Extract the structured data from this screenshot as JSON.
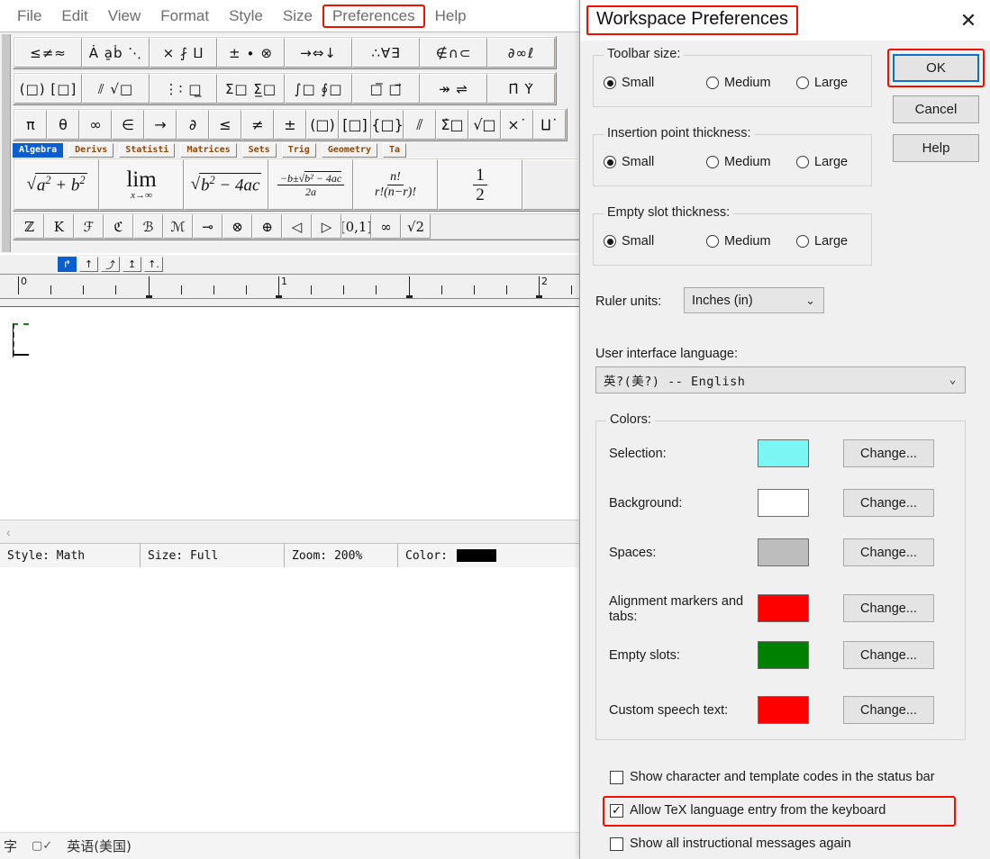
{
  "app": {
    "menu": [
      {
        "label": "File",
        "highlighted": false
      },
      {
        "label": "Edit",
        "highlighted": false
      },
      {
        "label": "View",
        "highlighted": false
      },
      {
        "label": "Format",
        "highlighted": false
      },
      {
        "label": "Style",
        "highlighted": false
      },
      {
        "label": "Size",
        "highlighted": false
      },
      {
        "label": "Preferences",
        "highlighted": true
      },
      {
        "label": "Help",
        "highlighted": false
      }
    ],
    "toolbar": {
      "row1": [
        "≤≠≈",
        "Ȧ a̱ḃ ⋱",
        "⨯ ⨏ ⨿",
        "± ∙ ⊗",
        "→⇔↓",
        "∴∀∃",
        "∉∩⊂",
        "∂∞ℓ"
      ],
      "row2": [
        "(□) [□]",
        "⫽ √□",
        "⋮∶ □̲",
        "Σ□ Σ̲□",
        "∫□ ∮□",
        "□̅ □⃗",
        "↠ ⇌",
        "Π̇ Υ̇"
      ],
      "row3": [
        "π",
        "θ",
        "∞",
        "∈",
        "→",
        "∂",
        "≤",
        "≠",
        "±",
        "(□)",
        "[□]",
        "{□}",
        "⫽",
        "Σ̇□",
        "√□",
        "⨯˙",
        "⨿˙"
      ],
      "tabs": [
        {
          "label": "Algebra",
          "active": true
        },
        {
          "label": "Derivs",
          "active": false
        },
        {
          "label": "Statisti",
          "active": false
        },
        {
          "label": "Matrices",
          "active": false
        },
        {
          "label": "Sets",
          "active": false
        },
        {
          "label": "Trig",
          "active": false
        },
        {
          "label": "Geometry",
          "active": false
        },
        {
          "label": "Ta",
          "active": false
        }
      ],
      "row4": [
        "ℤ",
        "K",
        "ℱ",
        "ℭ",
        "ℬ",
        "ℳ",
        "⊸",
        "⊗",
        "⊕",
        "◁",
        "▷",
        "[0,1]",
        "∞",
        "√2"
      ]
    },
    "ruler": {
      "units_major": [
        "0",
        "1",
        "2"
      ]
    },
    "statusbar": {
      "style": "Style: Math",
      "size": "Size: Full",
      "zoom": "Zoom: 200%",
      "color_label": "Color:",
      "color_value": "#000000"
    },
    "imebar": {
      "mode": "字",
      "language": "英语(美国)"
    },
    "canvas": {
      "empty_slot_color": "#108810"
    }
  },
  "dialog": {
    "title": "Workspace Preferences",
    "close_icon": "✕",
    "buttons": {
      "ok": "OK",
      "cancel": "Cancel",
      "help": "Help"
    },
    "groups": [
      {
        "title": "Toolbar size:",
        "options": [
          {
            "label": "Small",
            "checked": true
          },
          {
            "label": "Medium",
            "checked": false
          },
          {
            "label": "Large",
            "checked": false
          }
        ]
      },
      {
        "title": "Insertion point thickness:",
        "options": [
          {
            "label": "Small",
            "checked": true
          },
          {
            "label": "Medium",
            "checked": false
          },
          {
            "label": "Large",
            "checked": false
          }
        ]
      },
      {
        "title": "Empty slot thickness:",
        "options": [
          {
            "label": "Small",
            "checked": true
          },
          {
            "label": "Medium",
            "checked": false
          },
          {
            "label": "Large",
            "checked": false
          }
        ]
      }
    ],
    "ruler_units": {
      "label": "Ruler units:",
      "value": "Inches (in)"
    },
    "ui_language": {
      "label": "User interface language:",
      "value": "英?(美?)  --  English"
    },
    "colors": {
      "title": "Colors:",
      "change_label": "Change...",
      "rows": [
        {
          "label": "Selection:",
          "color": "#7cf5f5"
        },
        {
          "label": "Background:",
          "color": "#ffffff"
        },
        {
          "label": "Spaces:",
          "color": "#bdbdbd"
        },
        {
          "label": "Alignment markers and tabs:",
          "color": "#fe0000"
        },
        {
          "label": "Empty slots:",
          "color": "#008000"
        },
        {
          "label": "Custom speech text:",
          "color": "#fe0000"
        }
      ]
    },
    "checkboxes": [
      {
        "label": "Show character and template codes in the status bar",
        "checked": false,
        "highlighted": false
      },
      {
        "label": "Allow TeX language entry from the keyboard",
        "checked": true,
        "highlighted": true
      },
      {
        "label": "Show all instructional messages again",
        "checked": false,
        "highlighted": false
      }
    ],
    "annotation_color": "#f01000"
  }
}
